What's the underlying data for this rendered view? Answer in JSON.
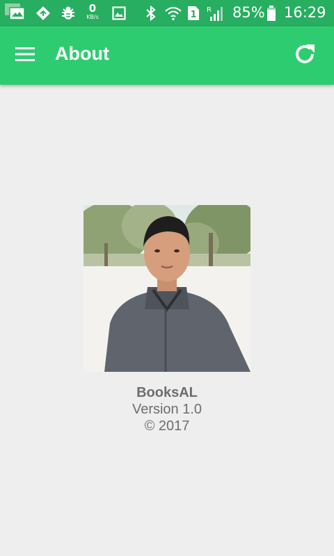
{
  "status_bar": {
    "net_speed_value": "0",
    "net_speed_unit": "KB/s",
    "sim_slot": "1",
    "roaming": "R",
    "battery_percent": "85%",
    "time": "16:29",
    "icons": [
      "screen-cast-icon",
      "diamond-arrow-icon",
      "bug-icon",
      "image-icon",
      "bluetooth-icon",
      "wifi-icon",
      "sim-icon",
      "signal-icon",
      "battery-icon"
    ]
  },
  "toolbar": {
    "title": "About",
    "left_icon": "menu-icon",
    "right_icon": "refresh-icon",
    "color": "#2ecc71"
  },
  "about": {
    "photo": "profile-photo",
    "app_name": "BooksAL",
    "version": "Version 1.0",
    "copyright": "© 2017"
  },
  "colors": {
    "status_bar": "#27ae60",
    "toolbar": "#2ecc71",
    "background": "#eeeeee",
    "text": "#6d6d6d"
  }
}
